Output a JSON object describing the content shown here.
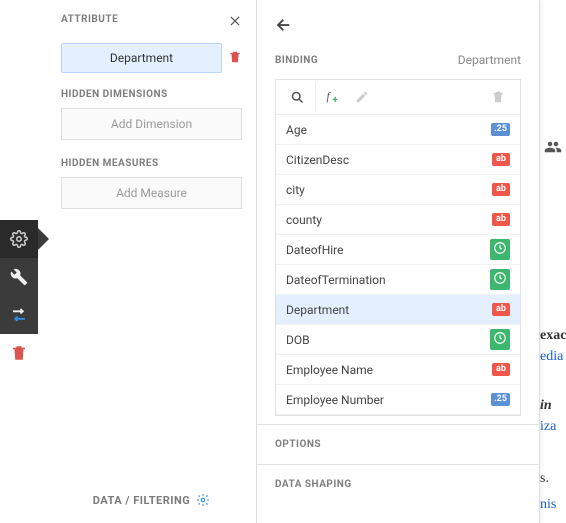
{
  "vtoolbar": {
    "settings_icon": "gear-icon",
    "tools_icon": "wrench-icon",
    "connect_icon": "arrows-icon",
    "delete_icon": "trash-icon"
  },
  "attribute_panel": {
    "title": "ATTRIBUTE",
    "current_attribute": "Department",
    "hidden_dimensions_title": "HIDDEN DIMENSIONS",
    "add_dimension_label": "Add Dimension",
    "hidden_measures_title": "HIDDEN MEASURES",
    "add_measure_label": "Add Measure",
    "footer_label": "DATA / FILTERING"
  },
  "binding_panel": {
    "title": "BINDING",
    "bound_field": "Department",
    "options_title": "OPTIONS",
    "data_shaping_title": "DATA SHAPING",
    "badge_text": {
      "num": ".25",
      "txt": "ab"
    },
    "fields": [
      {
        "name": "Age",
        "type": "num"
      },
      {
        "name": "CitizenDesc",
        "type": "txt"
      },
      {
        "name": "city",
        "type": "txt"
      },
      {
        "name": "county",
        "type": "txt"
      },
      {
        "name": "DateofHire",
        "type": "dt"
      },
      {
        "name": "DateofTermination",
        "type": "dt"
      },
      {
        "name": "Department",
        "type": "txt",
        "selected": true
      },
      {
        "name": "DOB",
        "type": "dt"
      },
      {
        "name": "Employee Name",
        "type": "txt"
      },
      {
        "name": "Employee Number",
        "type": "num"
      }
    ]
  },
  "bg": {
    "frag1": "exac",
    "frag2": "edia",
    "frag3": "in",
    "frag4": "iza",
    "frag5": "s.",
    "frag6": "nis"
  }
}
